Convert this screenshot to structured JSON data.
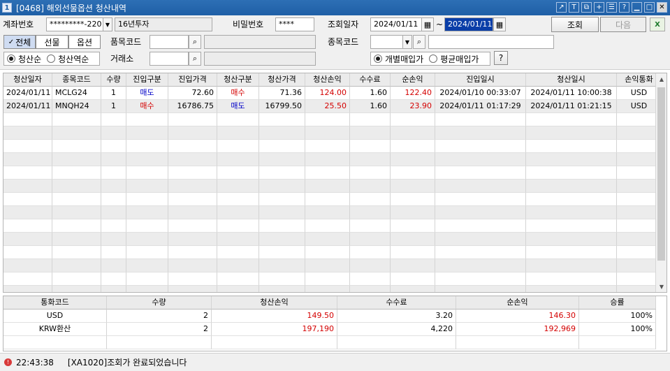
{
  "window": {
    "number": "1",
    "title": "[0468] 해외선물옵션 청산내역"
  },
  "toolbar_icons": [
    "external-link-icon",
    "text-icon",
    "copy-icon",
    "plus-icon",
    "list-icon",
    "help-icon",
    "minimize-icon",
    "maximize-icon",
    "close-icon"
  ],
  "title_glyphs": {
    "t": "T",
    "help": "?"
  },
  "form": {
    "account_label": "계좌번호",
    "account_value": "*********-220",
    "account_name": "16년투자",
    "password_label": "비밀번호",
    "password_value": "****",
    "date_label": "조회일자",
    "date_from": "2024/01/11",
    "date_sep": "~",
    "date_to": "2024/01/11",
    "query_button": "조회",
    "next_button": "다음",
    "filter_all": "전체",
    "filter_futures": "선물",
    "filter_options": "옵션",
    "product_code_label": "품목코드",
    "item_code_label": "종목코드",
    "order_label1": "청산순",
    "order_label2": "청산역순",
    "exchange_label": "거래소",
    "price_label1": "개별매입가",
    "price_label2": "평균매입가",
    "help_button": "?"
  },
  "grid": {
    "columns": [
      "청산일자",
      "종목코드",
      "수량",
      "진입구분",
      "진입가격",
      "청산구분",
      "청산가격",
      "청산손익",
      "수수료",
      "순손익",
      "진입일시",
      "청산일시",
      "손익통화"
    ],
    "rows": [
      [
        "2024/01/11",
        "MCLG24",
        "1",
        "매도",
        "72.60",
        "매수",
        "71.36",
        "124.00",
        "1.60",
        "122.40",
        "2024/01/10 00:33:07",
        "2024/01/11 10:00:38",
        "USD"
      ],
      [
        "2024/01/11",
        "MNQH24",
        "1",
        "매수",
        "16786.75",
        "매도",
        "16799.50",
        "25.50",
        "1.60",
        "23.90",
        "2024/01/11 01:17:29",
        "2024/01/11 01:21:15",
        "USD"
      ]
    ]
  },
  "summary": {
    "columns": [
      "통화코드",
      "수량",
      "청산손익",
      "수수료",
      "순손익",
      "승률"
    ],
    "rows": [
      [
        "USD",
        "2",
        "149.50",
        "3.20",
        "146.30",
        "100%"
      ],
      [
        "KRW환산",
        "2",
        "197,190",
        "4,220",
        "192,969",
        "100%"
      ]
    ]
  },
  "status": {
    "time": "22:43:38",
    "message": "[XA1020]조회가 완료되었습니다"
  },
  "colors": {
    "title_bar": "#1f5fa6",
    "profit": "#d40000",
    "sell": "#0000c8"
  }
}
